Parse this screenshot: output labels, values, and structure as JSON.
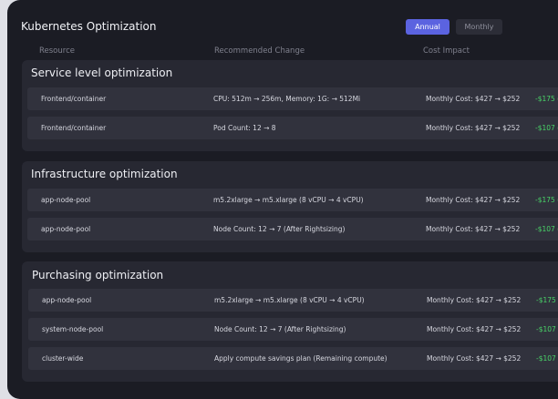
{
  "title": "Kubernetes Optimization",
  "toggle": {
    "annual": "Annual",
    "monthly": "Monthly",
    "selected": "Annual"
  },
  "columns": {
    "resource": "Resource",
    "change": "Recommended Change",
    "cost": "Cost Impact"
  },
  "colors": {
    "accent": "#5b63e0",
    "savings": "#49d468"
  },
  "sections": [
    {
      "title": "Service level optimization",
      "rows": [
        {
          "resource": "Frontend/container",
          "change": "CPU: 512m → 256m, Memory: 1G: → 512Mi",
          "cost": "Monthly Cost: $427 → $252",
          "impact": "-$175 ("
        },
        {
          "resource": "Frontend/container",
          "change": "Pod Count: 12 → 8",
          "cost": "Monthly Cost: $427 → $252",
          "impact": "-$107 ("
        }
      ]
    },
    {
      "title": "Infrastructure optimization",
      "rows": [
        {
          "resource": "app-node-pool",
          "change": "m5.2xlarge → m5.xlarge (8 vCPU → 4 vCPU)",
          "cost": "Monthly Cost: $427 → $252",
          "impact": "-$175 ("
        },
        {
          "resource": "app-node-pool",
          "change": "Node Count: 12 → 7 (After Rightsizing)",
          "cost": "Monthly Cost: $427 → $252",
          "impact": "-$107 ("
        }
      ]
    },
    {
      "title": "Purchasing optimization",
      "rows": [
        {
          "resource": "app-node-pool",
          "change": "m5.2xlarge → m5.xlarge (8 vCPU → 4 vCPU)",
          "cost": "Monthly Cost: $427 → $252",
          "impact": "-$175 ("
        },
        {
          "resource": "system-node-pool",
          "change": "Node Count: 12 → 7 (After Rightsizing)",
          "cost": "Monthly Cost: $427 → $252",
          "impact": "-$107 ("
        },
        {
          "resource": "cluster-wide",
          "change": "Apply compute savings plan (Remaining compute)",
          "cost": "Monthly Cost: $427 → $252",
          "impact": "-$107 ("
        }
      ]
    }
  ]
}
